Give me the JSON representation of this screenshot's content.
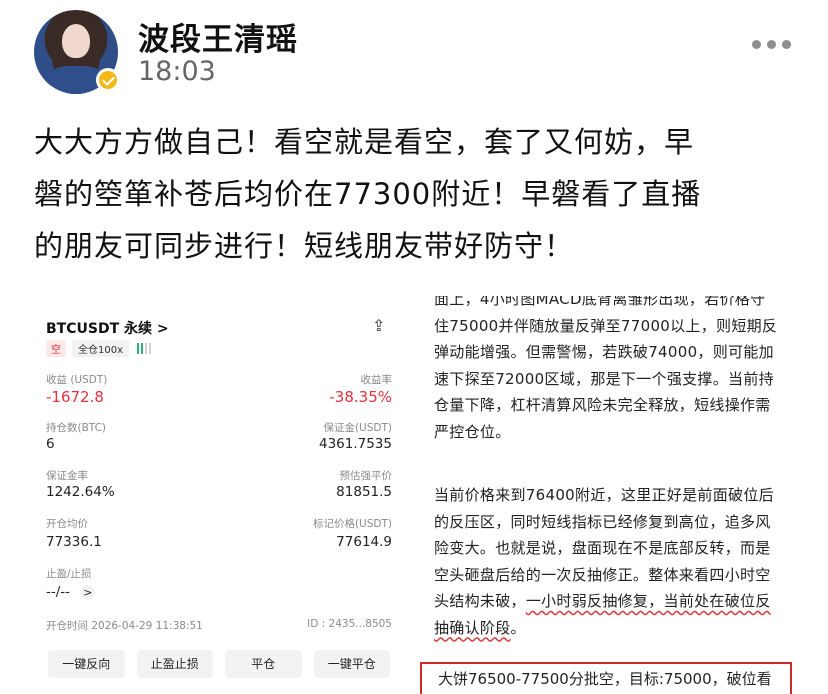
{
  "author": {
    "name": "波段王清瑶",
    "time": "18:03"
  },
  "post": {
    "lines": [
      "大大方方做自己！看空就是看空，套了又何妨，早",
      "磐的箜箪补苍后均价在77300附近！早磐看了直播",
      "的朋友可同步进行！短线朋友带好防守！"
    ]
  },
  "position_card": {
    "symbol": "BTCUSDT 永续",
    "symbol_chevron": ">",
    "side": "空",
    "leverage": "全仓100x",
    "pnl_label": "收益 (USDT)",
    "pnl_value": "-1672.8",
    "roi_label": "收益率",
    "roi_value": "-38.35%",
    "size_label": "持仓数(BTC)",
    "size_value": "6",
    "margin_label": "保证金(USDT)",
    "margin_value": "4361.7535",
    "margin_ratio_label": "保证金率",
    "margin_ratio_value": "1242.64%",
    "liq_label": "预估强平价",
    "liq_value": "81851.5",
    "entry_label": "开仓均价",
    "entry_value": "77336.1",
    "mark_label": "标记价格(USDT)",
    "mark_value": "77614.9",
    "tpsl_label": "止盈/止损",
    "tpsl_value": "--/--",
    "tpsl_chevron": ">",
    "open_time": "开仓时间 2026-04-29 11:38:51",
    "id": "ID : 2435...8505",
    "buttons": [
      "一键反向",
      "止盈止损",
      "平仓",
      "一键平仓"
    ],
    "colors": {
      "negative": "#e2323f",
      "positive": "#2fb37a"
    }
  },
  "analysis": {
    "para1": [
      "面上，4小时图MACD底背离雏形出现，若价格守",
      "住75000并伴随放量反弹至77000以上，则短期反",
      "弹动能增强。但需警惕，若跌破74000，则可能加",
      "速下探至72000区域，那是下一个强支撑。当前持",
      "仓量下降，杠杆清算风险未完全释放，短线操作需",
      "严控仓位。"
    ],
    "para2": [
      "当前价格来到76400附近，这里正好是前面破位后",
      "的反压区，同时短线指标已经修复到高位，追多风",
      "险变大。也就是说，盘面现在不是底部反转，而是",
      "空头砸盘后给的一次反抽修正。整体来看四小时空"
    ],
    "line_tail_a": "头结构未破，",
    "line_tail_b": "一小时弱反抽修复，当前处在破位反",
    "line_last": "抽确认阶段",
    "line_last_end": "。",
    "boxed_line": "大饼76500-77500分批空，目标:75000，破位看"
  }
}
